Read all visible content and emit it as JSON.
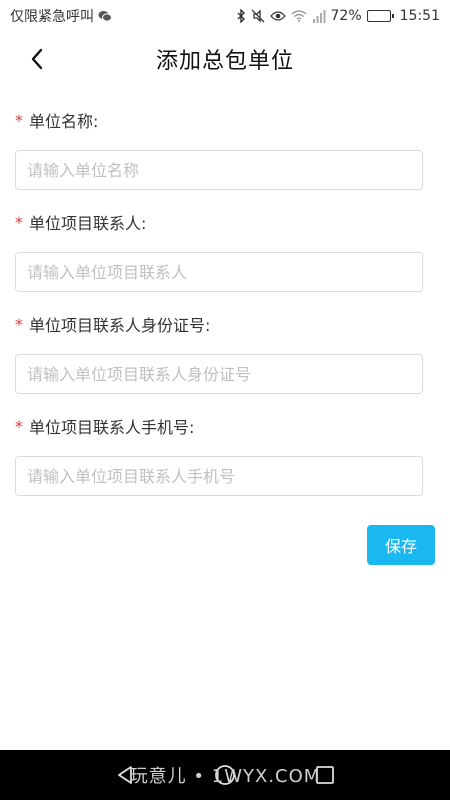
{
  "status_bar": {
    "left_text": "仅限紧急呼叫",
    "battery_percent": "72%",
    "battery_level": 0.72,
    "time": "15:51",
    "icons": [
      "wechat-icon",
      "bluetooth-icon",
      "mute-icon",
      "eye-icon",
      "wifi-icon",
      "signal-icon",
      "battery-icon"
    ]
  },
  "header": {
    "title": "添加总包单位",
    "back_icon": "chevron-left-icon"
  },
  "form": {
    "required_mark": "*",
    "fields": [
      {
        "label": "单位名称:",
        "placeholder": "请输入单位名称",
        "value": ""
      },
      {
        "label": "单位项目联系人:",
        "placeholder": "请输入单位项目联系人",
        "value": ""
      },
      {
        "label": "单位项目联系人身份证号:",
        "placeholder": "请输入单位项目联系人身份证号",
        "value": ""
      },
      {
        "label": "单位项目联系人手机号:",
        "placeholder": "请输入单位项目联系人手机号",
        "value": ""
      }
    ],
    "save_label": "保存"
  },
  "colors": {
    "accent": "#1ab8f0",
    "required": "#e53935",
    "border": "#dcdcdc",
    "placeholder": "#c0c0c0",
    "navbar": "#000000"
  },
  "navbar": {
    "watermark": "玩意儿 • 1WYX.COM",
    "icons": [
      "back-triangle-icon",
      "home-circle-icon",
      "recents-square-icon"
    ]
  }
}
